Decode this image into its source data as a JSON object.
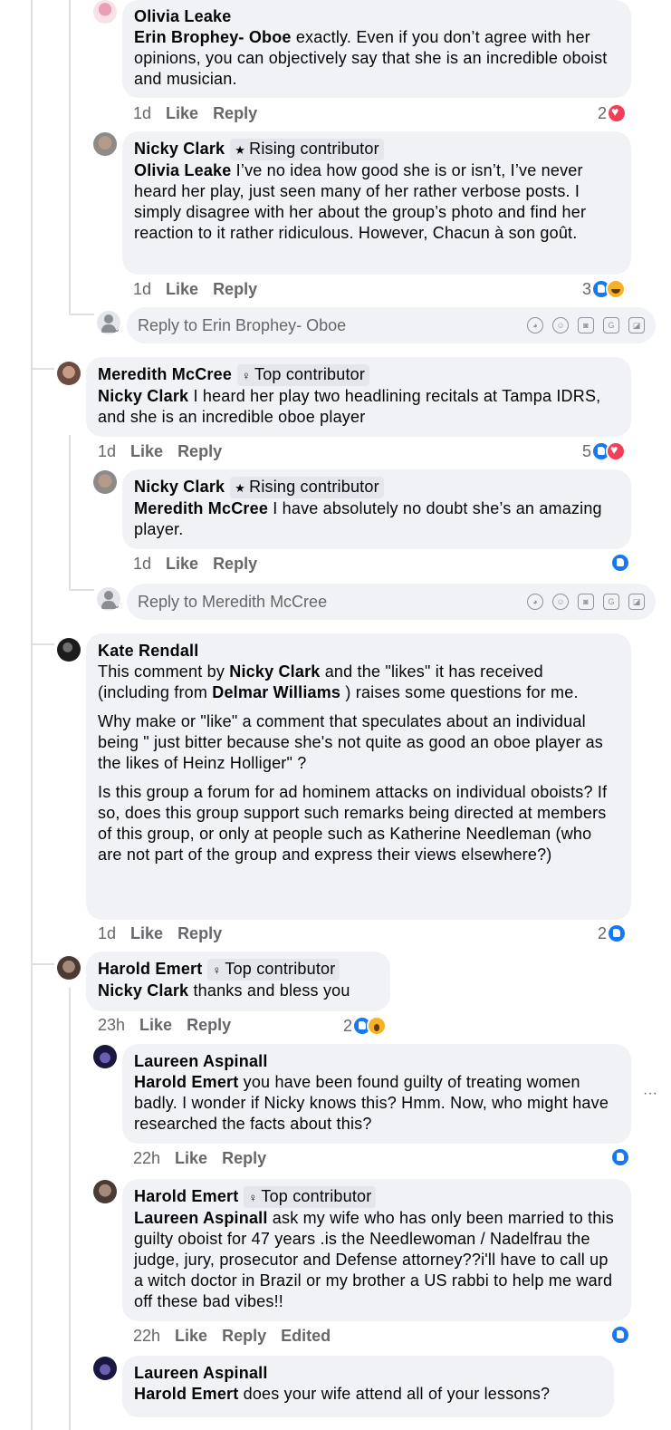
{
  "comments": [
    {
      "author": "Olivia Leake",
      "mention": "Erin Brophey- Oboe",
      "text": " exactly. Even if you don’t agree with her opinions, you can objectively say that she is an incredible oboist and musician.",
      "time": "1d",
      "like": "Like",
      "reply": "Reply",
      "reaction_count": "2",
      "reactions": [
        "love"
      ]
    },
    {
      "author": "Nicky Clark",
      "badge": "Rising contributor",
      "mention": "Olivia Leake",
      "text": " I’ve no idea how good she is or isn’t, I’ve never heard her play, just seen many of her rather verbose posts. I simply disagree with her about the group’s photo and find her reaction to it rather ridiculous. However, Chacun à son goût.",
      "time": "1d",
      "like": "Like",
      "reply": "Reply",
      "reaction_count": "3",
      "reactions": [
        "like",
        "haha"
      ]
    },
    {
      "author": "Meredith McCree",
      "badge": "Top contributor",
      "mention": "Nicky Clark",
      "text": " I heard her play two headlining recitals at Tampa IDRS, and she is an incredible oboe player",
      "time": "1d",
      "like": "Like",
      "reply": "Reply",
      "reaction_count": "5",
      "reactions": [
        "like",
        "love"
      ]
    },
    {
      "author": "Nicky Clark",
      "badge": "Rising contributor",
      "mention": "Meredith McCree",
      "text": " I have absolutely no doubt she’s an amazing player.",
      "time": "1d",
      "like": "Like",
      "reply": "Reply",
      "reaction_count": "",
      "reactions": [
        "like"
      ]
    },
    {
      "author": "Kate Rendall",
      "p1_a": "This comment by ",
      "p1_m1": "Nicky Clark",
      "p1_b": " and the \"likes\" it has received (including from ",
      "p1_m2": "Delmar Williams",
      "p1_c": " ) raises some questions for me.",
      "p2": "Why make or \"like\" a comment that speculates about an individual being \" just bitter because she's not quite as good an oboe player as the likes of Heinz Holliger\" ?",
      "p3": "Is this group a forum for ad hominem attacks on individual oboists? If so, does this group support such remarks being directed at members of this group, or only at people such as Katherine Needleman (who are not part of the group and express their views elsewhere?)",
      "time": "1d",
      "like": "Like",
      "reply": "Reply",
      "reaction_count": "2",
      "reactions": [
        "like"
      ]
    },
    {
      "author": "Harold Emert",
      "badge": "Top contributor",
      "mention": "Nicky Clark",
      "text": " thanks and bless you",
      "time": "23h",
      "like": "Like",
      "reply": "Reply",
      "reaction_count": "2",
      "reactions": [
        "like",
        "wow"
      ]
    },
    {
      "author": "Laureen Aspinall",
      "mention": "Harold Emert",
      "text": " you have been found guilty of treating women badly. I wonder if Nicky knows this? Hmm. Now, who might have researched the facts about this?",
      "time": "22h",
      "like": "Like",
      "reply": "Reply",
      "reaction_count": "",
      "reactions": [
        "like"
      ]
    },
    {
      "author": "Harold Emert",
      "badge": "Top contributor",
      "mention": "Laureen Aspinall",
      "text": " ask my wife who has only been married to this guilty oboist for 47 years .is the Needlewoman / Nadelfrau the judge, jury, prosecutor and Defense attorney??i'll have to call up a witch doctor in Brazil or my brother a US rabbi to help me ward off these bad vibes!!",
      "time": "22h",
      "like": "Like",
      "reply": "Reply",
      "edited": "Edited",
      "reaction_count": "",
      "reactions": [
        "like"
      ]
    },
    {
      "author": "Laureen Aspinall",
      "mention": "Harold Emert",
      "text": " does your wife attend all of your lessons?"
    }
  ],
  "reply_boxes": [
    {
      "placeholder": "Reply to Erin Brophey- Oboe"
    },
    {
      "placeholder": "Reply to Meredith McCree"
    }
  ],
  "more_options": "···",
  "colors": {
    "bubble": "#f0f2f5",
    "like": "#1877f2",
    "love": "#f33e58",
    "meta": "#65676b"
  }
}
